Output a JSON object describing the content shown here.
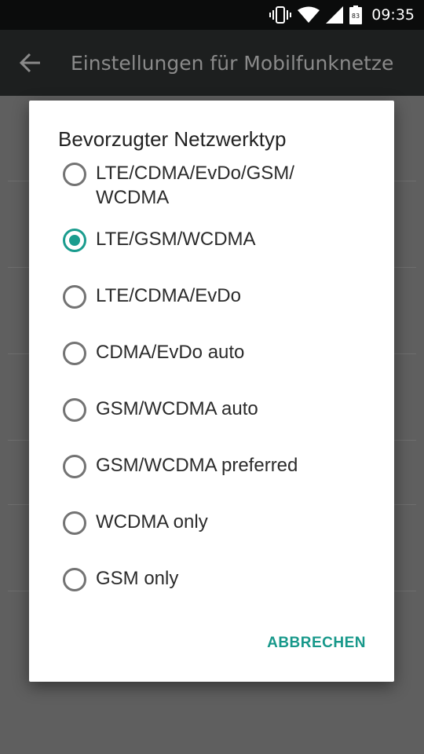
{
  "status_bar": {
    "time": "09:35",
    "battery_level": "83",
    "icons": [
      "vibrate-icon",
      "wifi-icon",
      "signal-icon",
      "battery-icon"
    ]
  },
  "app_bar": {
    "title": "Einstellungen für Mobilfunknetze"
  },
  "dialog": {
    "title": "Bevorzugter Netzwerktyp",
    "options": [
      {
        "label": "LTE/CDMA/EvDo/GSM/\nWCDMA",
        "selected": false
      },
      {
        "label": "LTE/GSM/WCDMA",
        "selected": true
      },
      {
        "label": "LTE/CDMA/EvDo",
        "selected": false
      },
      {
        "label": "CDMA/EvDo auto",
        "selected": false
      },
      {
        "label": "GSM/WCDMA auto",
        "selected": false
      },
      {
        "label": "GSM/WCDMA preferred",
        "selected": false
      },
      {
        "label": "WCDMA only",
        "selected": false
      },
      {
        "label": "GSM only",
        "selected": false
      }
    ],
    "cancel_label": "ABBRECHEN"
  },
  "colors": {
    "accent": "#1a9c8e",
    "status_bar": "#0b0c0c",
    "app_bar": "#1d1f1f"
  }
}
